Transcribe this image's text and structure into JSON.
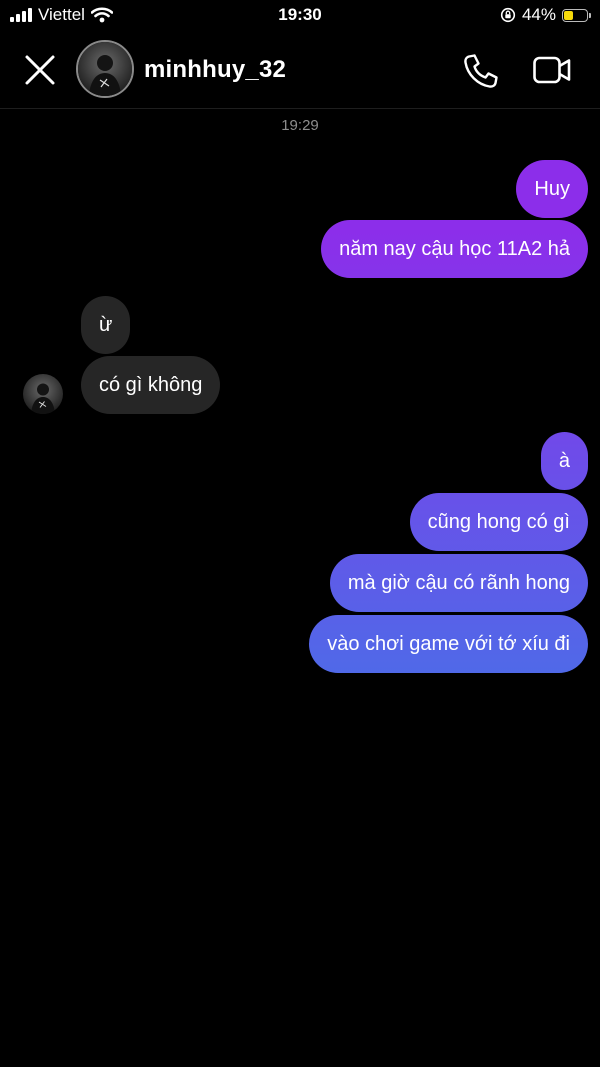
{
  "status_bar": {
    "carrier": "Viettel",
    "time": "19:30",
    "battery_text": "44%",
    "battery_level": 0.44,
    "battery_color": "#f5d90a",
    "icons": [
      "signal-icon",
      "wifi-icon",
      "rotation-lock-icon",
      "battery-icon"
    ]
  },
  "header": {
    "username": "minhhuy_32",
    "icons": [
      "close-icon",
      "avatar",
      "phone-icon",
      "video-camera-icon"
    ]
  },
  "chat": {
    "timestamp": "19:29",
    "colors": {
      "incoming_bubble": "#262626",
      "outgoing_gradient_top": "#8c2eea",
      "outgoing_gradient_bottom": "#4f6ae8"
    },
    "messages": [
      {
        "from": "me",
        "text": "Huy"
      },
      {
        "from": "me",
        "text": "năm nay cậu học 11A2 hả"
      },
      {
        "from": "them",
        "text": "ừ"
      },
      {
        "from": "them",
        "text": "có gì không"
      },
      {
        "from": "me",
        "text": "à"
      },
      {
        "from": "me",
        "text": "cũng hong có gì"
      },
      {
        "from": "me",
        "text": "mà giờ cậu có rãnh hong"
      },
      {
        "from": "me",
        "text": "vào chơi game với tớ xíu đi"
      }
    ]
  }
}
